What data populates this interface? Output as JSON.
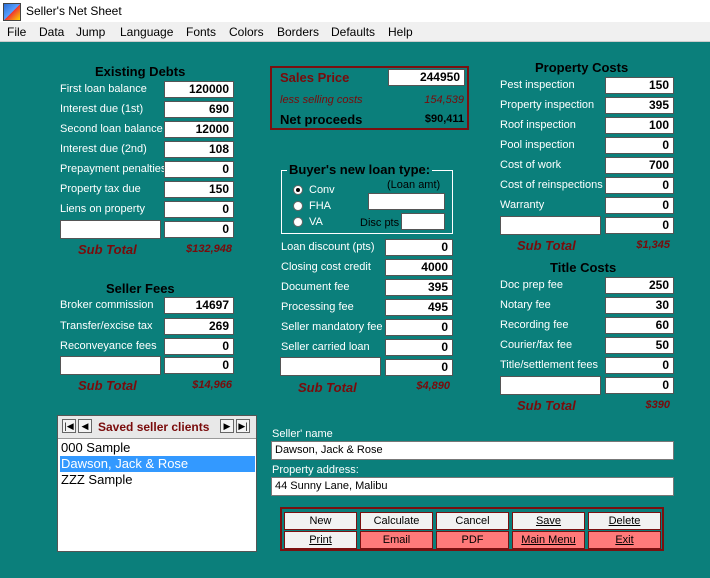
{
  "window": {
    "title": "Seller's Net Sheet"
  },
  "menu": [
    "File",
    "Data",
    "Jump",
    "Language",
    "Fonts",
    "Colors",
    "Borders",
    "Defaults",
    "Help"
  ],
  "existing_debts": {
    "title": "Existing Debts",
    "rows": [
      {
        "label": "First loan balance",
        "value": "120000"
      },
      {
        "label": "Interest due (1st)",
        "value": "690"
      },
      {
        "label": "Second loan balance",
        "value": "12000"
      },
      {
        "label": "Interest due (2nd)",
        "value": "108"
      },
      {
        "label": "Prepayment penalties",
        "value": "0"
      },
      {
        "label": "Property tax due",
        "value": "150"
      },
      {
        "label": "Liens on property",
        "value": "0"
      },
      {
        "label": "",
        "value": "0"
      }
    ],
    "subtotal_label": "Sub Total",
    "subtotal": "$132,948"
  },
  "seller_fees": {
    "title": "Seller Fees",
    "rows": [
      {
        "label": "Broker commission",
        "value": "14697"
      },
      {
        "label": "Transfer/excise tax",
        "value": "269"
      },
      {
        "label": "Reconveyance fees",
        "value": "0"
      },
      {
        "label": "",
        "value": "0"
      }
    ],
    "subtotal_label": "Sub Total",
    "subtotal": "$14,966"
  },
  "sales": {
    "sales_price_label": "Sales Price",
    "sales_price": "244950",
    "selling_costs_label": "less selling costs",
    "selling_costs": "154,539",
    "net_label": "Net proceeds",
    "net": "$90,411"
  },
  "buyer_loan": {
    "title": "Buyer's new loan type:",
    "loan_amt_label": "(Loan amt)",
    "options": [
      "Conv",
      "FHA",
      "VA"
    ],
    "disc_label": "Disc pts"
  },
  "middle_costs": {
    "rows": [
      {
        "label": "Loan discount (pts)",
        "value": "0"
      },
      {
        "label": "Closing cost credit",
        "value": "4000"
      },
      {
        "label": "Document fee",
        "value": "395"
      },
      {
        "label": "Processing fee",
        "value": "495"
      },
      {
        "label": "Seller mandatory fee",
        "value": "0"
      },
      {
        "label": "Seller carried loan",
        "value": "0"
      },
      {
        "label": "",
        "value": "0"
      }
    ],
    "subtotal_label": "Sub Total",
    "subtotal": "$4,890"
  },
  "property_costs": {
    "title": "Property Costs",
    "rows": [
      {
        "label": "Pest inspection",
        "value": "150"
      },
      {
        "label": "Property inspection",
        "value": "395"
      },
      {
        "label": "Roof inspection",
        "value": "100"
      },
      {
        "label": "Pool inspection",
        "value": "0"
      },
      {
        "label": "Cost of work",
        "value": "700"
      },
      {
        "label": "Cost of reinspections",
        "value": "0"
      },
      {
        "label": "Warranty",
        "value": "0"
      },
      {
        "label": "",
        "value": "0"
      }
    ],
    "subtotal_label": "Sub Total",
    "subtotal": "$1,345"
  },
  "title_costs": {
    "title": "Title Costs",
    "rows": [
      {
        "label": "Doc prep fee",
        "value": "250"
      },
      {
        "label": "Notary fee",
        "value": "30"
      },
      {
        "label": "Recording fee",
        "value": "60"
      },
      {
        "label": "Courier/fax fee",
        "value": "50"
      },
      {
        "label": "Title/settlement fees",
        "value": "0"
      },
      {
        "label": "",
        "value": "0"
      }
    ],
    "subtotal_label": "Sub Total",
    "subtotal": "$390"
  },
  "saved_clients": {
    "title": "Saved seller clients",
    "items": [
      "000 Sample",
      "Dawson, Jack & Rose",
      "ZZZ Sample"
    ]
  },
  "seller": {
    "name_label": "Seller' name",
    "name": "Dawson, Jack & Rose",
    "address_label": "Property address:",
    "address": "44 Sunny Lane, Malibu"
  },
  "buttons": {
    "new": "New",
    "calculate": "Calculate",
    "cancel": "Cancel",
    "save": "Save",
    "delete": "Delete",
    "print": "Print",
    "email": "Email",
    "pdf": "PDF",
    "main_menu": "Main Menu",
    "exit": "Exit"
  },
  "colors": {
    "background": "#0b7f7b",
    "accent": "#7b1010",
    "button_red": "#ff7a7a"
  }
}
